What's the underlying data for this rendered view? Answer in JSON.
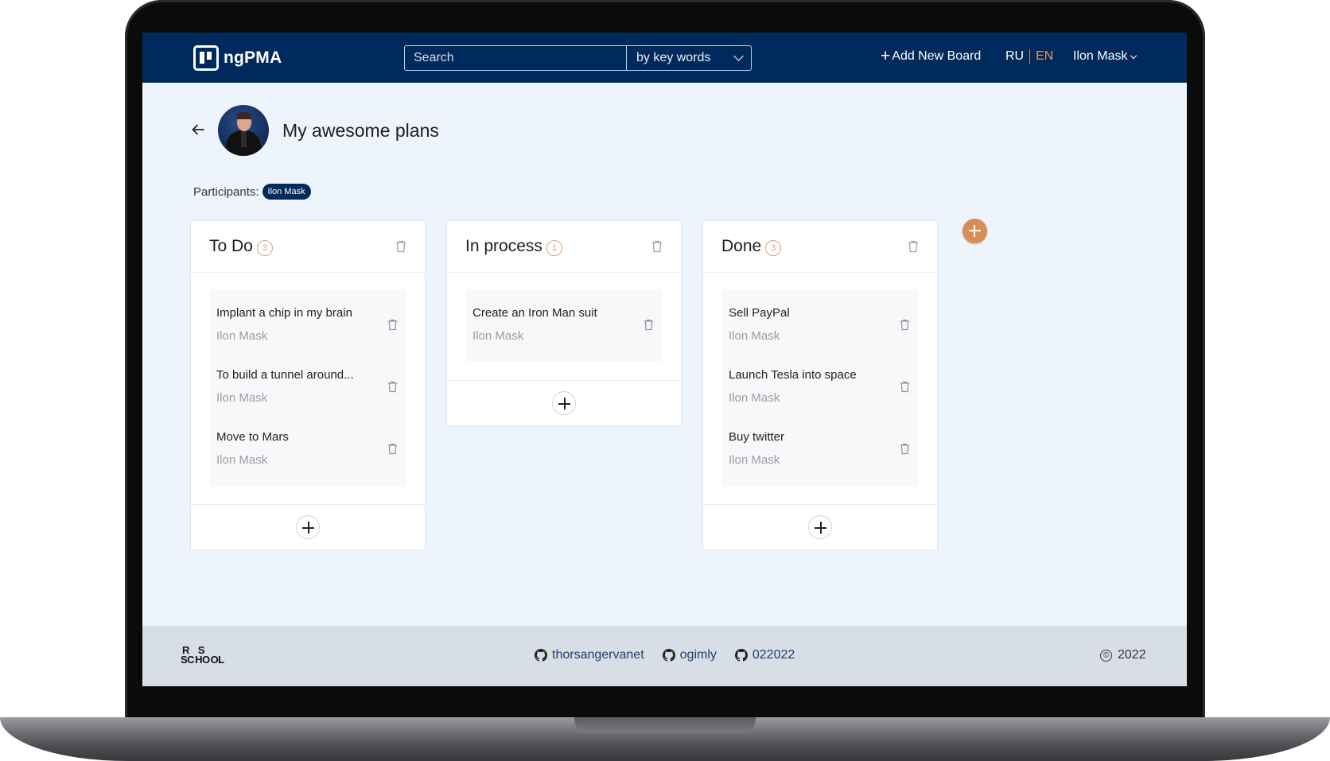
{
  "header": {
    "logo_text": "ngPMA",
    "search_placeholder": "Search",
    "search_mode": "by key words",
    "add_board_label": "Add New Board",
    "lang_ru": "RU",
    "lang_en": "EN",
    "user_name": "Ilon Mask"
  },
  "board": {
    "title": "My awesome plans",
    "participants_label": "Participants:",
    "participants": [
      "Ilon Mask"
    ]
  },
  "columns": [
    {
      "title": "To Do",
      "count": "3",
      "tasks": [
        {
          "title": "Implant a chip in my brain",
          "author": "Ilon Mask"
        },
        {
          "title": "To build a tunnel around...",
          "author": "Ilon Mask"
        },
        {
          "title": "Move to Mars",
          "author": "Ilon Mask"
        }
      ]
    },
    {
      "title": "In process",
      "count": "1",
      "tasks": [
        {
          "title": "Create an Iron Man suit",
          "author": "Ilon Mask"
        }
      ]
    },
    {
      "title": "Done",
      "count": "3",
      "tasks": [
        {
          "title": "Sell PayPal",
          "author": "Ilon Mask"
        },
        {
          "title": "Launch Tesla into space",
          "author": "Ilon Mask"
        },
        {
          "title": "Buy twitter",
          "author": "Ilon Mask"
        }
      ]
    }
  ],
  "footer": {
    "school_logo": "RS SCHOOL",
    "links": [
      "thorsangervanet",
      "ogimly",
      "022022"
    ],
    "copyright_symbol": "©",
    "year": "2022"
  },
  "colors": {
    "header_bg": "#002a5c",
    "accent": "#d98d55",
    "page_bg": "#edf4fb",
    "footer_bg": "#d7dee5"
  },
  "icons": {
    "logo": "board-logo-icon",
    "back": "arrow-left-icon",
    "delete": "trash-icon",
    "add": "plus-icon",
    "github": "github-icon",
    "dropdown": "chevron-down-icon"
  }
}
